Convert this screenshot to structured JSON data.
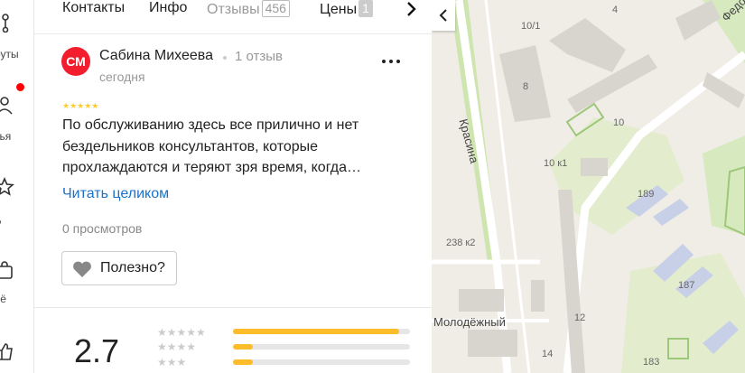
{
  "rail": {
    "items": [
      {
        "label": "руты"
      },
      {
        "label": "зья"
      },
      {
        "label": "д"
      },
      {
        "label": "ьё"
      }
    ]
  },
  "tabs": [
    {
      "label": "Контакты"
    },
    {
      "label": "Инфо"
    },
    {
      "label": "Отзывы",
      "count": "456"
    },
    {
      "label": "Цены",
      "count": "1"
    }
  ],
  "review": {
    "avatar_initials": "СМ",
    "author": "Сабина Михеева",
    "reviews_count": "1 отзыв",
    "date": "сегодня",
    "stars": "★★★★★",
    "text": "По обслуживанию здесь все прилично и нет бездельников консультантов, которые прохлаждаются и теряют зря время, когда…",
    "read_more": "Читать целиком",
    "views": "0 просмотров",
    "useful_label": "Полезно?"
  },
  "rating": {
    "value": "2.7",
    "distribution": [
      {
        "stars": "★★★★★",
        "fraction": 0.94
      },
      {
        "stars": "★★★★",
        "fraction": 0.11
      },
      {
        "stars": "★★★",
        "fraction": 0.11
      }
    ]
  },
  "map": {
    "labels": [
      "4",
      "10/1",
      "8",
      "Красина",
      "10",
      "10 к1",
      "189",
      "238 к2",
      "187",
      "Молодёжный",
      "12",
      "14",
      "183",
      "Федо"
    ]
  },
  "colors": {
    "accent_link": "#1a73c8",
    "star": "#fc3",
    "bar_fill": "#fdbd2a",
    "avatar": "#f21e2e",
    "notification_dot": "#ff0000"
  }
}
